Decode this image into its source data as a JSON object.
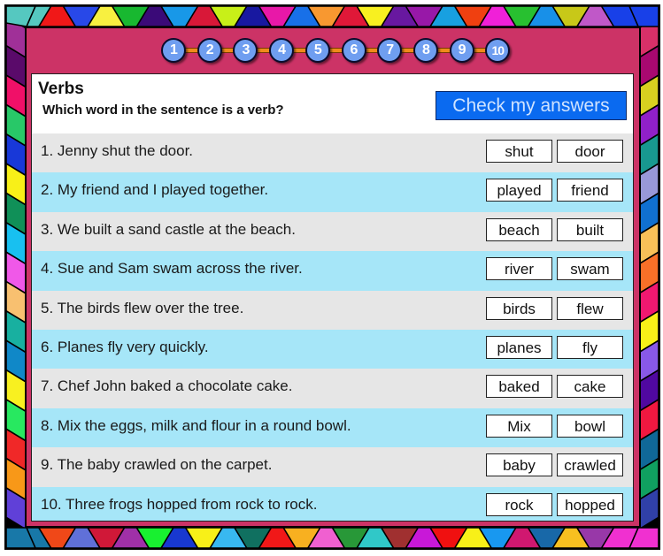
{
  "nav": {
    "questions": [
      "1",
      "2",
      "3",
      "4",
      "5",
      "6",
      "7",
      "8",
      "9",
      "10"
    ]
  },
  "header": {
    "title": "Verbs",
    "subtitle": "Which word in the sentence is a verb?",
    "check_button": "Check my answers"
  },
  "questions": [
    {
      "sentence": "1. Jenny shut the door.",
      "options": [
        "shut",
        "door"
      ]
    },
    {
      "sentence": "2. My friend and I played together.",
      "options": [
        "played",
        "friend"
      ]
    },
    {
      "sentence": "3. We built a sand castle at the beach.",
      "options": [
        "beach",
        "built"
      ]
    },
    {
      "sentence": "4. Sue and Sam swam across the river.",
      "options": [
        "river",
        "swam"
      ]
    },
    {
      "sentence": "5. The birds flew over the tree.",
      "options": [
        "birds",
        "flew"
      ]
    },
    {
      "sentence": "6. Planes fly very quickly.",
      "options": [
        "planes",
        "fly"
      ]
    },
    {
      "sentence": "7. Chef John baked a chocolate cake.",
      "options": [
        "baked",
        "cake"
      ]
    },
    {
      "sentence": "8. Mix the eggs, milk and flour in a round bowl.",
      "options": [
        "Mix",
        "bowl"
      ]
    },
    {
      "sentence": "9. The baby crawled on the carpet.",
      "options": [
        "baby",
        "crawled"
      ]
    },
    {
      "sentence": "10. Three frogs hopped from rock to rock.",
      "options": [
        "rock",
        "hopped"
      ]
    }
  ],
  "colors": {
    "panel": "#cc3366",
    "button": "#0a6af0",
    "nav_dot": "#6f9ef0",
    "row_grey": "#e6e6e6",
    "row_blue": "#a6e6f8",
    "nav_line": "#f08a1a"
  },
  "border_colors": {
    "top": [
      "#55c8c0",
      "#f01818",
      "#2848e8",
      "#f8f040",
      "#18b830",
      "#3a0a78",
      "#1898e8",
      "#d81838",
      "#c8f018",
      "#1818a0",
      "#e818a8",
      "#1870e8",
      "#f89830",
      "#e01838",
      "#f8f020",
      "#6818a0",
      "#9818a8",
      "#18a0e0",
      "#f04010",
      "#f020d8",
      "#28c030",
      "#1890e8",
      "#c8c818",
      "#c058c8",
      "#1840e8"
    ],
    "bottom": [
      "#1878a8",
      "#f04818",
      "#6070d8",
      "#d01838",
      "#a030a8",
      "#18f030",
      "#1838d0",
      "#f8f018",
      "#38b8f0",
      "#107060",
      "#f01818",
      "#f8b020",
      "#f060d0",
      "#289838",
      "#30c8c8",
      "#a03030",
      "#c818d8",
      "#f01010",
      "#f8f018",
      "#1898f0",
      "#d01870",
      "#1868a8",
      "#f8c020",
      "#9838a8",
      "#f030d0"
    ],
    "left": [
      "#a03098",
      "#5a0a6a",
      "#f01068",
      "#28c868",
      "#1838d8",
      "#f8f018",
      "#109058",
      "#18c0f0",
      "#f058e8",
      "#f8c070",
      "#18b0a0",
      "#1088c8",
      "#f8f020",
      "#28e860",
      "#f02828",
      "#f89818",
      "#6040d8"
    ],
    "right": [
      "#d83068",
      "#a80870",
      "#d8d020",
      "#9020c8",
      "#189890",
      "#9898d8",
      "#1070d0",
      "#f8c058",
      "#f87028",
      "#f01870",
      "#f8f018",
      "#8858e8",
      "#5008a0",
      "#f01840",
      "#106898",
      "#10a060",
      "#3040a8"
    ]
  }
}
